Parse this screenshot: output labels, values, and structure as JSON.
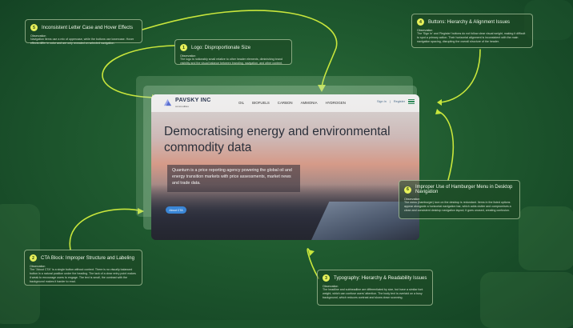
{
  "colors": {
    "accent": "#c8e63c",
    "badge": "#e6f05a",
    "cta": "#3a86d6",
    "bg": "#1f5a2f"
  },
  "callouts": [
    {
      "num": "5",
      "title": "Inconsistent Letter Case and Hover Effects",
      "obs": "Observation",
      "body": "Navigation items use a mix of uppercase, while the buttons use lowercase. Hover effects differ in color and are only revealed on selected navigation."
    },
    {
      "num": "1",
      "title": "Logo: Disproportionate Size",
      "obs": "Observation",
      "body": "The logo is noticeably small relative to other header elements, diminishing brand visibility and the visual balance between branding, navigation, and other content."
    },
    {
      "num": "4",
      "title": "Buttons: Hierarchy & Alignment Issues",
      "obs": "Observation",
      "body": "The 'Sign In' and 'Register' buttons do not follow clear visual weight, making it difficult to spot a primary action. Their horizontal alignment is inconsistent with the main navigation spacing, disrupting the overall structure of the header."
    },
    {
      "num": "6",
      "title": "Improper Use of Hamburger Menu in Desktop Navigation",
      "obs": "Observation",
      "body": "The menu (hamburger) icon on the desktop is redundant. Items in the listed options appear alongside a horizontal navigation bar, which adds clutter and compromises a clean and consistent desktop navigation layout; it goes unused, creating confusion."
    },
    {
      "num": "2",
      "title": "CTA Block: Improper Structure and Labeling",
      "obs": "Observation",
      "body": "The \"About CTA\" is a single button without context. There is no visually balanced button in a natural position under the heading. The lack of a clear entry point makes it weak to encourage users to engage. The text is small, the contrast with the background makes it harder to read."
    },
    {
      "num": "3",
      "title": "Typography: Hierarchy & Readability Issues",
      "obs": "Observation",
      "body": "The headline and subheadline are differentiated by size, but have a similar font weight, which can confuse users' attention. The body text is overlaid on a busy background, which reduces contrast and slows down scanning."
    }
  ],
  "site": {
    "logo": "PAVSKY INC",
    "logo_sub": "commodities",
    "nav": [
      "OIL",
      "BIOFUELS",
      "CARBON",
      "AMMONIA",
      "HYDROGEN"
    ],
    "signin": "Sign In",
    "register": "Register",
    "headline": "Democratising energy and environmental commodity data",
    "body": "Quantum is a price reporting agency powering the global oil and energy transition markets with price assessments, market news and trade data.",
    "cta": "About CTA"
  }
}
